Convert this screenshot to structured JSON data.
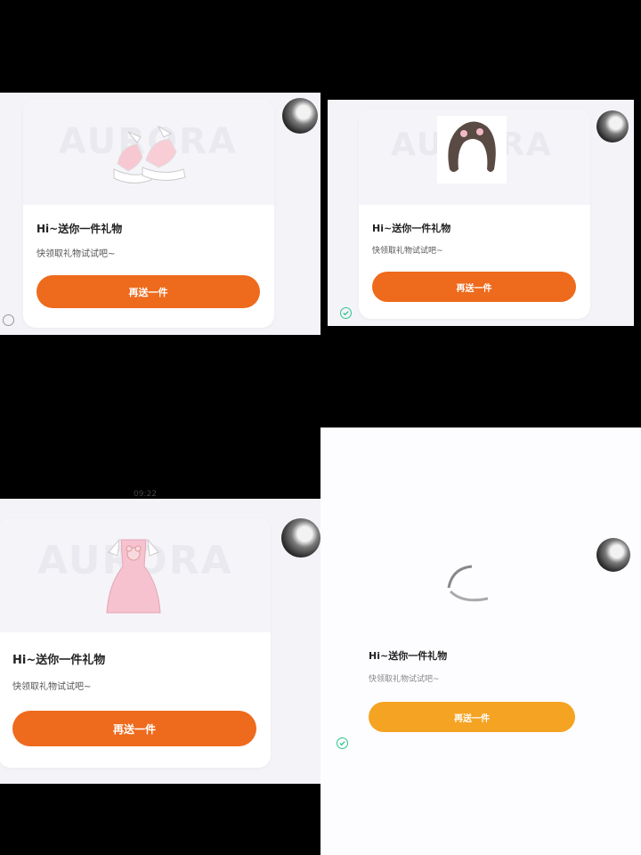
{
  "card": {
    "title": "Hi~送你一件礼物",
    "subtitle": "快领取礼物试试吧~",
    "button_label": "再送一件"
  },
  "watermark": "AURORA",
  "timestamp": "09:22",
  "panels": [
    {
      "name": "panel-shoes",
      "item": "shoes-icon",
      "selected": false
    },
    {
      "name": "panel-hair",
      "item": "hair-icon",
      "selected": true
    },
    {
      "name": "panel-dress",
      "item": "dress-icon",
      "selected": false
    },
    {
      "name": "panel-loading",
      "item": "loading-icon",
      "selected": true
    }
  ],
  "colors": {
    "button_orange": "#ee6a1c",
    "button_light_orange": "#f5a323",
    "check_green": "#2ec28a",
    "panel_bg": "#f4f4f8"
  }
}
